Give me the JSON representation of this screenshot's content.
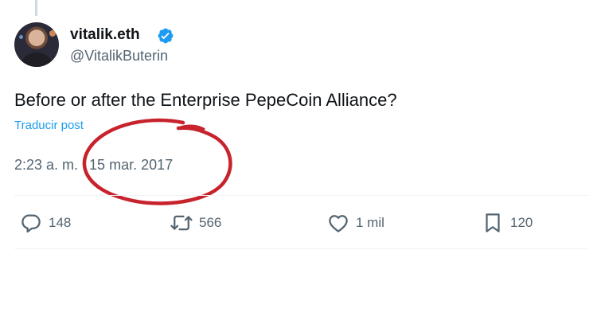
{
  "author": {
    "display_name": "vitalik.eth",
    "handle": "@VitalikButerin",
    "verified": true
  },
  "tweet": {
    "text": "Before or after the Enterprise PepeCoin Alliance?",
    "translate_label": "Traducir post",
    "time": "2:23 a. m.",
    "separator": "·",
    "date": "15 mar. 2017"
  },
  "actions": {
    "replies": "148",
    "reposts": "566",
    "likes": "1 mil",
    "bookmarks": "120"
  },
  "colors": {
    "link": "#1d9bf0",
    "muted": "#536471",
    "text": "#0f1419",
    "verified_badge": "#1d9bf0",
    "annotation_circle": "#c8232c"
  },
  "icons": [
    "verified-badge-icon",
    "reply-icon",
    "repost-icon",
    "like-icon",
    "bookmark-icon"
  ]
}
